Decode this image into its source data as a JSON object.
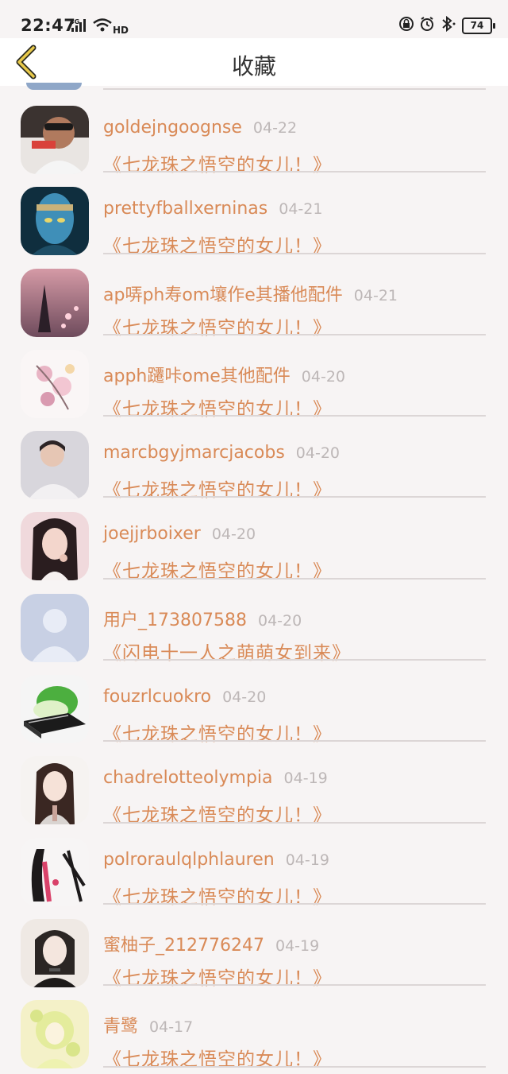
{
  "status_bar": {
    "time": "22:47",
    "network": "4G",
    "wifi_label": "HD",
    "battery": "74"
  },
  "nav": {
    "title": "收藏",
    "back_icon": "chevron-left-icon"
  },
  "items": [
    {
      "user": "goldejngoognse",
      "date": "04-22",
      "title": "《七龙珠之悟空的女儿！》"
    },
    {
      "user": "prettyfballxerninas",
      "date": "04-21",
      "title": "《七龙珠之悟空的女儿！》"
    },
    {
      "user": "ap哢ph寿om壤作e其播他配件",
      "date": "04-21",
      "title": "《七龙珠之悟空的女儿！》"
    },
    {
      "user": "apph躚咔ome其他配件",
      "date": "04-20",
      "title": "《七龙珠之悟空的女儿！》"
    },
    {
      "user": "marcbgyjmarcjacobs",
      "date": "04-20",
      "title": "《七龙珠之悟空的女儿！》"
    },
    {
      "user": "joejjrboixer",
      "date": "04-20",
      "title": "《七龙珠之悟空的女儿！》"
    },
    {
      "user": "用户_173807588",
      "date": "04-20",
      "title": "《闪电十一人之萌萌女到来》"
    },
    {
      "user": "fouzrlcuokro",
      "date": "04-20",
      "title": "《七龙珠之悟空的女儿！》"
    },
    {
      "user": "chadrelotteolympia",
      "date": "04-19",
      "title": "《七龙珠之悟空的女儿！》"
    },
    {
      "user": "polroraulqlphlauren",
      "date": "04-19",
      "title": "《七龙珠之悟空的女儿！》"
    },
    {
      "user": "蜜柚子_212776247",
      "date": "04-19",
      "title": "《七龙珠之悟空的女儿！》"
    },
    {
      "user": "青鹭",
      "date": "04-17",
      "title": "《七龙珠之悟空的女儿！》"
    }
  ]
}
